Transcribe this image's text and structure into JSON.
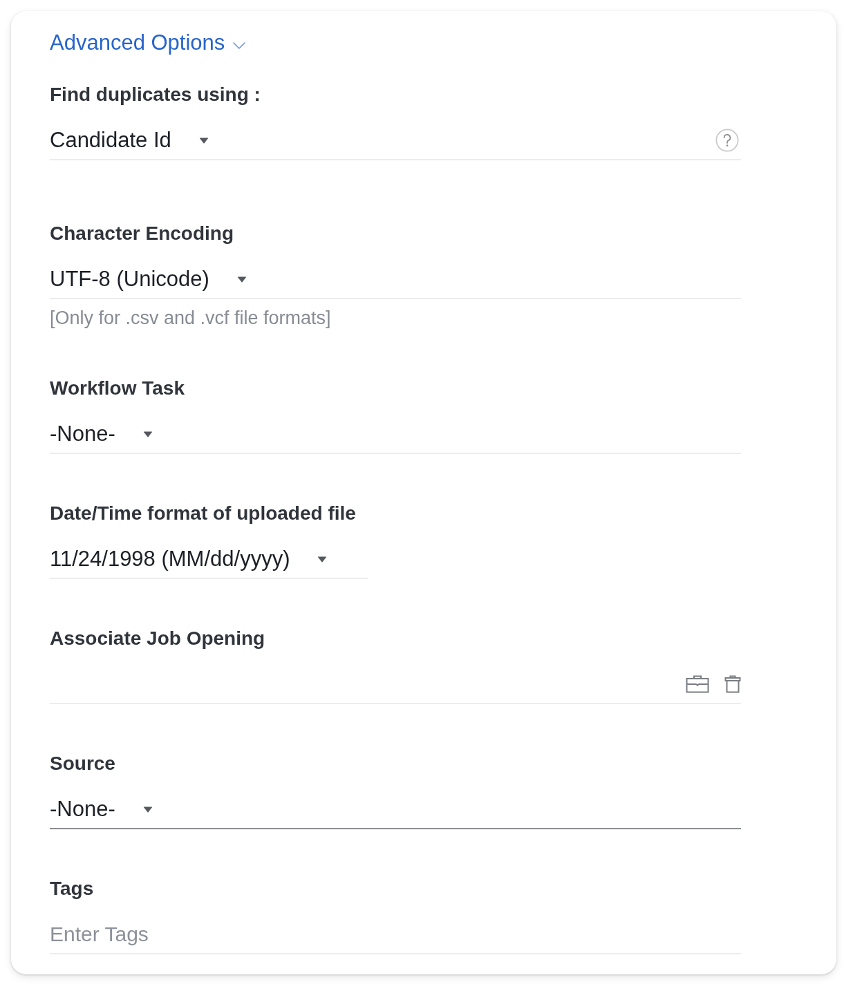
{
  "advanced_options": {
    "label": "Advanced Options",
    "expanded": true
  },
  "fields": [
    {
      "kind": "select",
      "label": "Find duplicates using :",
      "value": "Candidate Id",
      "help": true,
      "focused": false
    },
    {
      "kind": "select",
      "label": "Character Encoding",
      "value": "UTF-8 (Unicode)",
      "hint": "[Only for .csv and .vcf file formats]",
      "help": false,
      "focused": false
    },
    {
      "kind": "select",
      "label": "Workflow Task",
      "value": "-None-",
      "help": false,
      "focused": false
    },
    {
      "kind": "short-select",
      "label": "Date/Time format of uploaded file",
      "value": "11/24/1998 (MM/dd/yyyy)",
      "help": false,
      "focused": false
    },
    {
      "kind": "lookup",
      "label": "Associate Job Opening"
    },
    {
      "kind": "select",
      "label": "Source",
      "value": "-None-",
      "help": false,
      "focused": true
    },
    {
      "kind": "text",
      "label": "Tags",
      "placeholder": "Enter Tags"
    }
  ]
}
